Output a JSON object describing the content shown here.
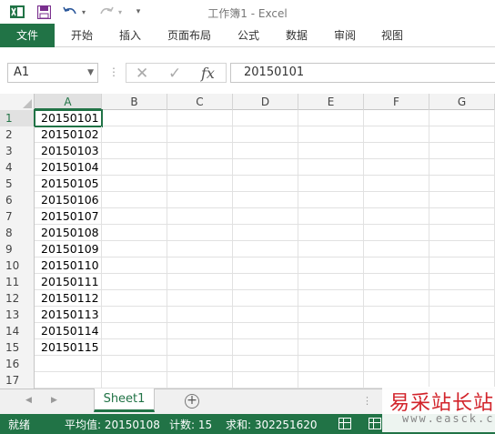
{
  "window": {
    "title": "工作簿1 - Excel"
  },
  "quick_access": [
    "excel-logo-icon",
    "save-icon",
    "undo-icon",
    "redo-icon",
    "customize-icon"
  ],
  "ribbon": {
    "tabs": [
      "文件",
      "开始",
      "插入",
      "页面布局",
      "公式",
      "数据",
      "审阅",
      "视图"
    ]
  },
  "formula_bar": {
    "name_box": "A1",
    "value": "20150101",
    "cancel_symbol": "✕",
    "enter_symbol": "✓",
    "fx_symbol": "fx"
  },
  "grid": {
    "columns": [
      "A",
      "B",
      "C",
      "D",
      "E",
      "F",
      "G"
    ],
    "rows": [
      {
        "num": "1",
        "a": "20150101"
      },
      {
        "num": "2",
        "a": "20150102"
      },
      {
        "num": "3",
        "a": "20150103"
      },
      {
        "num": "4",
        "a": "20150104"
      },
      {
        "num": "5",
        "a": "20150105"
      },
      {
        "num": "6",
        "a": "20150106"
      },
      {
        "num": "7",
        "a": "20150107"
      },
      {
        "num": "8",
        "a": "20150108"
      },
      {
        "num": "9",
        "a": "20150109"
      },
      {
        "num": "10",
        "a": "20150110"
      },
      {
        "num": "11",
        "a": "20150111"
      },
      {
        "num": "12",
        "a": "20150112"
      },
      {
        "num": "13",
        "a": "20150113"
      },
      {
        "num": "14",
        "a": "20150114"
      },
      {
        "num": "15",
        "a": "20150115"
      },
      {
        "num": "16",
        "a": ""
      },
      {
        "num": "17",
        "a": ""
      }
    ]
  },
  "sheets": {
    "tabs": [
      "Sheet1"
    ],
    "add_symbol": "+"
  },
  "status": {
    "mode": "就绪",
    "average": "平均值: 20150108",
    "count": "计数: 15",
    "sum": "求和: 302251620"
  },
  "watermark": {
    "text": "易采站长站",
    "url": "www.easck.com"
  },
  "colors": {
    "accent": "#217346",
    "watermark": "#d2232a"
  }
}
